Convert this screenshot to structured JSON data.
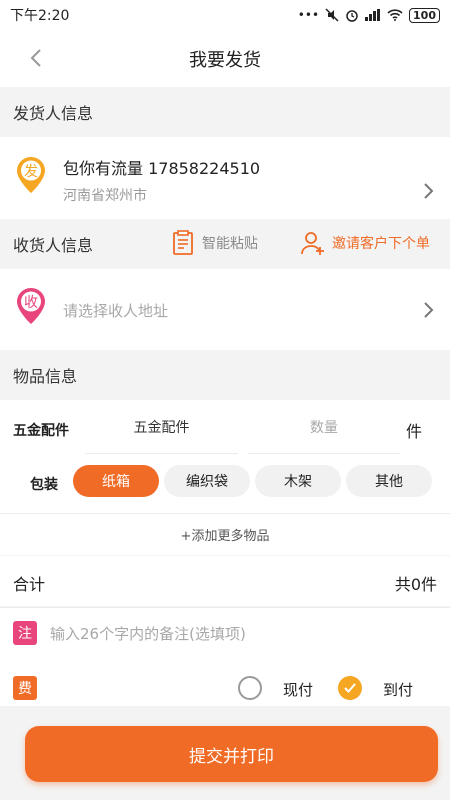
{
  "status": {
    "time": "下午2:20",
    "battery": "100"
  },
  "nav": {
    "title": "我要发货"
  },
  "sender": {
    "section_title": "发货人信息",
    "badge": "发",
    "name_phone": "包你有流量  17858224510",
    "address": "河南省郑州市"
  },
  "receiver": {
    "section_title": "收货人信息",
    "smart_paste": "智能粘贴",
    "invite": "邀请客户下个单",
    "badge": "收",
    "placeholder": "请选择收人地址"
  },
  "goods": {
    "section_title": "物品信息",
    "item_label": "五金配件",
    "item_name_value": "五金配件",
    "quantity_placeholder": "数量",
    "unit": "件",
    "pack_label": "包装",
    "pack_options": [
      "纸箱",
      "编织袋",
      "木架",
      "其他"
    ],
    "add_more": "+添加更多物品"
  },
  "total": {
    "label": "合计",
    "value": "共0件"
  },
  "remark": {
    "badge": "注",
    "placeholder": "输入26个字内的备注(选填项)"
  },
  "fee": {
    "badge": "费",
    "option_prepaid": "现付",
    "option_collect": "到付"
  },
  "submit": {
    "label": "提交并打印"
  },
  "colors": {
    "accent": "#f06b26",
    "pink": "#e7457c",
    "yellow": "#f5a623"
  }
}
